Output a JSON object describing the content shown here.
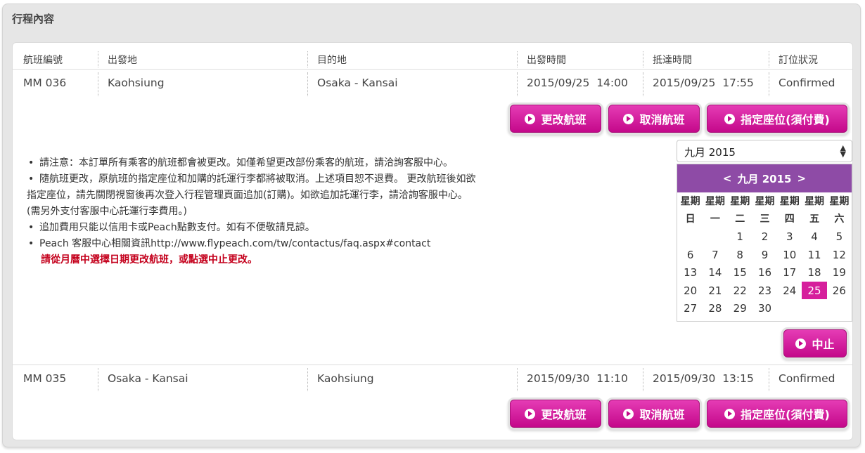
{
  "panel": {
    "title": "行程內容"
  },
  "columns": [
    "航班編號",
    "出發地",
    "目的地",
    "出發時間",
    "抵達時間",
    "訂位狀況"
  ],
  "flights": [
    {
      "flight_no": "MM 036",
      "origin": "Kaohsiung",
      "destination": "Osaka - Kansai",
      "depart": "2015/09/25  14:00",
      "arrive": "2015/09/25  17:55",
      "status": "Confirmed"
    },
    {
      "flight_no": "MM 035",
      "origin": "Osaka - Kansai",
      "destination": "Kaohsiung",
      "depart": "2015/09/30  11:10",
      "arrive": "2015/09/30  13:15",
      "status": "Confirmed"
    }
  ],
  "buttons": {
    "change": "更改航班",
    "cancel": "取消航班",
    "seat": "指定座位(須付費)",
    "stop": "中止"
  },
  "notes": {
    "n1": "請注意：本訂單所有乘客的航班都會被更改。如僅希望更改部份乘客的航班，請洽詢客服中心。",
    "n2a": "隨航班更改，原航班的指定座位和加購的託運行李都將被取消。上述項目恕不退費。 更改航班後如欲",
    "n2b": "指定座位，請先關閉視窗後再次登入行程管理頁面追加(訂購)。如欲追加託運行李，請洽詢客服中心。",
    "n2c": "(需另外支付客服中心託運行李費用。)",
    "n3": "追加費用只能以信用卡或Peach點數支付。如有不便敬請見諒。",
    "n4": "Peach 客服中心相關資訊http://www.flypeach.com/tw/contactus/faq.aspx#contact",
    "warning": "請從月曆中選擇日期更改航班，或點選中止更改。"
  },
  "calendar": {
    "selected_month": "九月 2015",
    "prev": "<",
    "title": "九月 2015",
    "next": ">",
    "dow_row1": [
      "星期",
      "星期",
      "星期",
      "星期",
      "星期",
      "星期",
      "星期"
    ],
    "dow_row2": [
      "日",
      "一",
      "二",
      "三",
      "四",
      "五",
      "六"
    ],
    "days": [
      "",
      "",
      "1",
      "2",
      "3",
      "4",
      "5",
      "6",
      "7",
      "8",
      "9",
      "10",
      "11",
      "12",
      "13",
      "14",
      "15",
      "16",
      "17",
      "18",
      "19",
      "20",
      "21",
      "22",
      "23",
      "24",
      "25",
      "26",
      "27",
      "28",
      "29",
      "30",
      "",
      "",
      ""
    ],
    "selected_day": "25",
    "accent": "#8e4ba6",
    "selected_color": "#d61f9c"
  },
  "colors": {
    "button": "#c4088a",
    "warning": "#c4001c"
  }
}
